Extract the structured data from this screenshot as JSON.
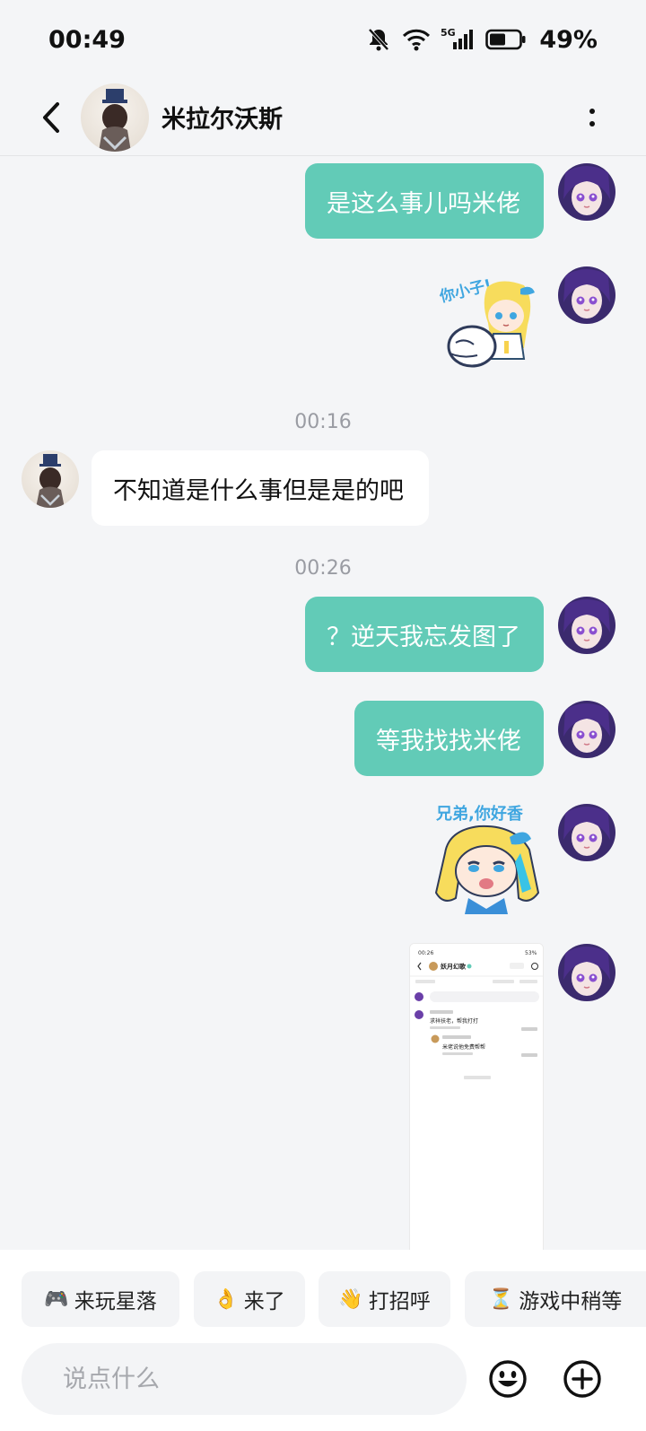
{
  "status_bar": {
    "time": "00:49",
    "battery": "49%",
    "network": "5G"
  },
  "header": {
    "title": "米拉尔沃斯"
  },
  "messages": [
    {
      "type": "text",
      "from": "me",
      "text": "是这么事儿吗米佬"
    },
    {
      "type": "sticker",
      "from": "me",
      "caption": "你小子!"
    },
    {
      "type": "time",
      "text": "00:16"
    },
    {
      "type": "text",
      "from": "peer",
      "text": "不知道是什么事但是是的吧"
    },
    {
      "type": "time",
      "text": "00:26"
    },
    {
      "type": "text",
      "from": "me",
      "text": "？逆天我忘发图了"
    },
    {
      "type": "text",
      "from": "me",
      "text": "等我找找米佬"
    },
    {
      "type": "sticker",
      "from": "me",
      "caption": "兄弟,你好香"
    },
    {
      "type": "image",
      "from": "me"
    }
  ],
  "screenshot": {
    "time": "00:26",
    "battery": "53%",
    "title": "妖月幻歌",
    "reply_1": "求祥扶老，帮我打打",
    "reply_2": "米佬说他免费帮帮"
  },
  "quick_replies": [
    {
      "emoji": "🎮",
      "label": "来玩星落"
    },
    {
      "emoji": "👌",
      "label": "来了"
    },
    {
      "emoji": "👋",
      "label": "打招呼"
    },
    {
      "emoji": "⏳",
      "label": "游戏中稍等"
    }
  ],
  "input": {
    "placeholder": "说点什么"
  },
  "colors": {
    "bubble_out": "#62cbb7",
    "bubble_in": "#ffffff",
    "background": "#f4f5f7"
  }
}
